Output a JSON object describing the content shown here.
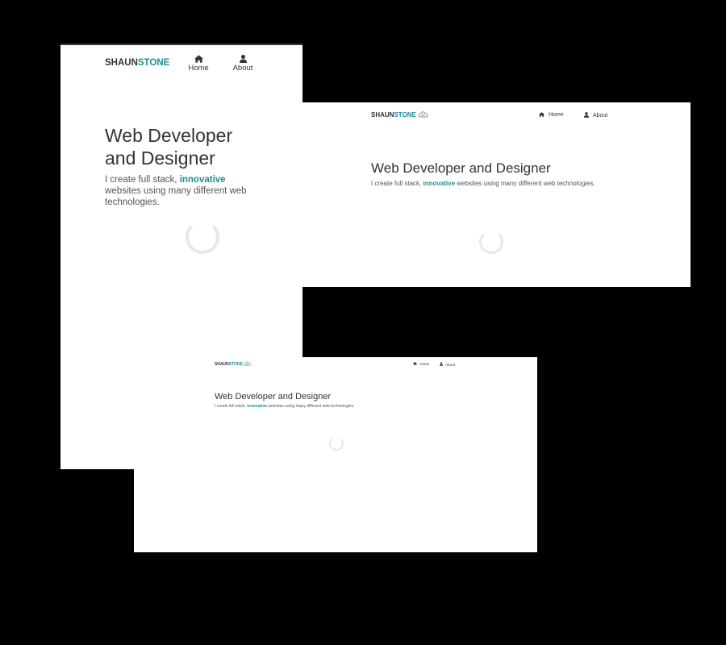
{
  "brand": {
    "first": "SHAUN",
    "second": "STONE",
    "accent_color": "#1a8f97",
    "icon": "house-logo-icon"
  },
  "nav": {
    "home_label": "Home",
    "home_icon": "home-icon",
    "about_label": "About",
    "about_icon": "user-icon"
  },
  "hero": {
    "title": "Web Developer and Designer",
    "title_line1": "Web Developer",
    "title_line2": "and Designer",
    "intro_before": "I create full stack, ",
    "intro_highlight": "innovative",
    "intro_after": " websites using many different web technologies."
  },
  "spinner": {
    "icon": "loading-spinner-icon",
    "color": "#e6e6e6"
  }
}
